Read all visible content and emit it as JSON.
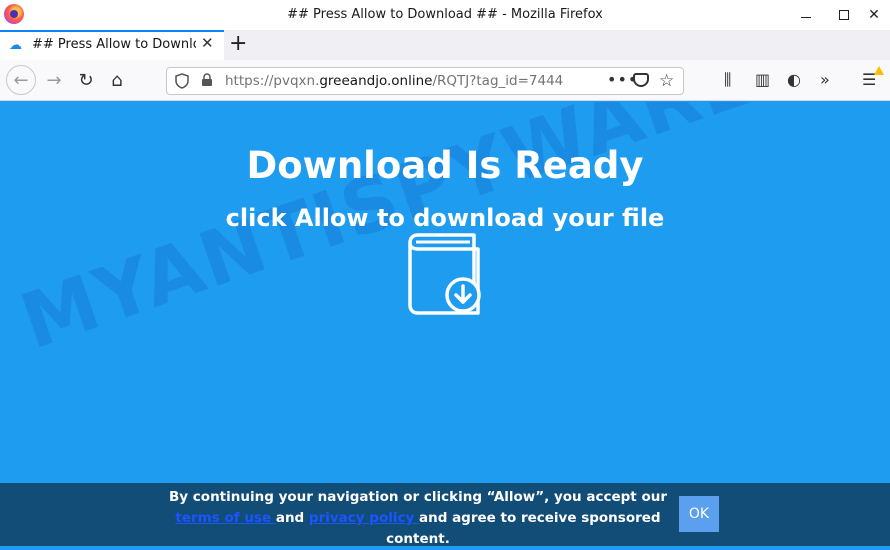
{
  "window": {
    "title": "## Press Allow to Download ## - Mozilla Firefox",
    "minimize_icon": "minimize-icon",
    "maximize_icon": "maximize-icon",
    "close_glyph": "✕"
  },
  "tab": {
    "title": "## Press Allow to Download ##",
    "favicon": "download-cloud-icon",
    "close_glyph": "✕",
    "new_tab_glyph": "+"
  },
  "nav": {
    "back_glyph": "←",
    "forward_glyph": "→",
    "reload_glyph": "↻",
    "home_glyph": "⌂"
  },
  "url": {
    "scheme": "https://pvqxn.",
    "host": "greeandjo.online",
    "path": "/RQTJ?tag_id=7444",
    "more_glyph": "•••",
    "star_glyph": "☆"
  },
  "toolbar": {
    "library_glyph": "⫼",
    "sidebar_glyph": "▥",
    "account_glyph": "◐",
    "overflow_glyph": "»",
    "menu_glyph": "☰"
  },
  "page": {
    "headline": "Download Is Ready",
    "subline": "click Allow to download your file",
    "watermark": "MYANTISPYWARE.COM"
  },
  "consent": {
    "text_before": "By continuing your navigation or clicking “Allow”, you accept our ",
    "terms_link": "terms of use ",
    "text_and": "and ",
    "privacy_link": "privacy policy ",
    "text_after": "and agree to receive sponsored content.",
    "ok_label": "OK"
  },
  "colors": {
    "page_background": "#1e9cf0",
    "consent_background": "#124d78",
    "link": "#1a55ff",
    "ok_button": "#5aa0ef",
    "tab_accent": "#0a84ff"
  }
}
